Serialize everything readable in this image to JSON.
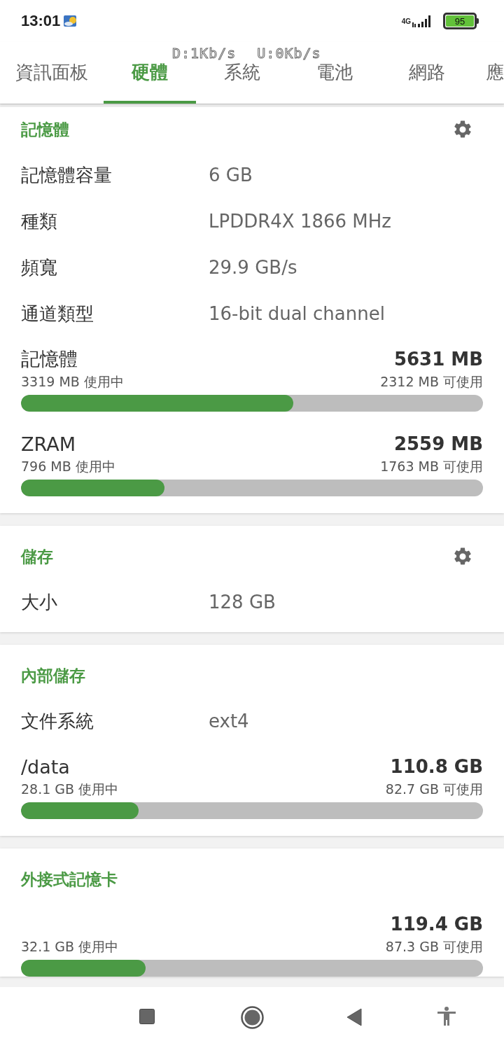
{
  "status_bar": {
    "time": "13:01",
    "network": "4G",
    "battery": "95"
  },
  "network_speed": {
    "download": "D:1Kb/s",
    "upload": "U:0Kb/s"
  },
  "tabs": [
    {
      "label": "資訊面板",
      "selected": false
    },
    {
      "label": "硬體",
      "selected": true
    },
    {
      "label": "系統",
      "selected": false
    },
    {
      "label": "電池",
      "selected": false
    },
    {
      "label": "網路",
      "selected": false
    },
    {
      "label": "應",
      "selected": false
    }
  ],
  "cards": [
    {
      "title": "記憶體",
      "settings": true,
      "rows": [
        {
          "label": "記憶體容量",
          "value": "6 GB"
        },
        {
          "label": "種類",
          "value": "LPDDR4X 1866 MHz"
        },
        {
          "label": "頻寬",
          "value": "29.9 GB/s"
        },
        {
          "label": "通道類型",
          "value": "16-bit dual channel"
        }
      ],
      "meters": [
        {
          "name": "記憶體",
          "total": "5631 MB",
          "used": "3319 MB 使用中",
          "available": "2312 MB 可使用",
          "level": 0.589
        },
        {
          "name": "ZRAM",
          "total": "2559 MB",
          "used": "796 MB 使用中",
          "available": "1763 MB 可使用",
          "level": 0.311
        }
      ]
    },
    {
      "title": "儲存",
      "settings": true,
      "rows": [
        {
          "label": "大小",
          "value": "128 GB"
        }
      ]
    },
    {
      "title": "內部儲存",
      "settings": false,
      "rows": [
        {
          "label": "文件系統",
          "value": "ext4"
        }
      ],
      "meters": [
        {
          "name": "/data",
          "total": "110.8 GB",
          "used": "28.1 GB 使用中",
          "available": "82.7 GB 可使用",
          "level": 0.254
        }
      ]
    },
    {
      "title": "外接式記憶卡",
      "settings": false,
      "meters": [
        {
          "total": "119.4 GB",
          "used": "32.1 GB 使用中",
          "available": "87.3 GB 可使用",
          "level": 0.269
        }
      ]
    }
  ]
}
